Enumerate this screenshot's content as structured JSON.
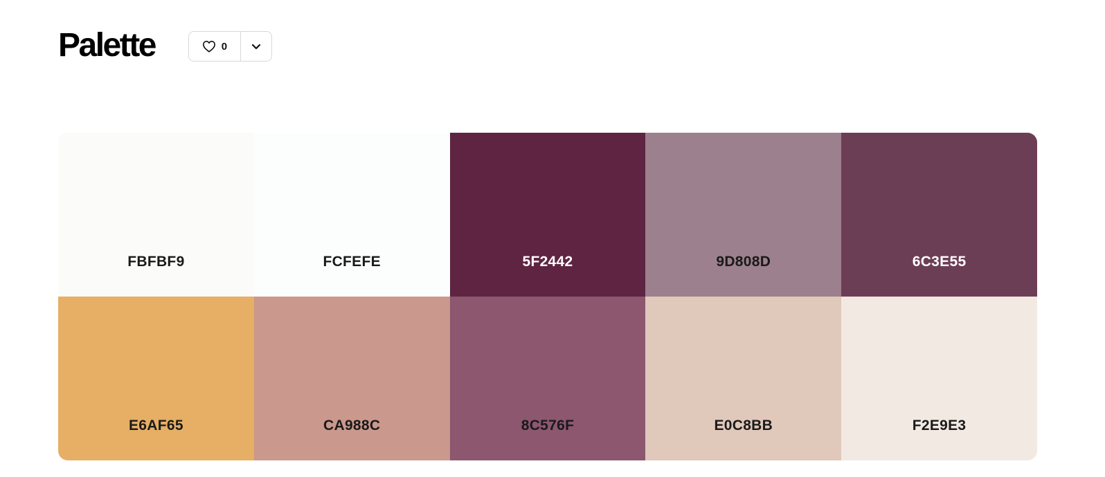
{
  "header": {
    "title": "Palette",
    "like_count": "0"
  },
  "icons": {
    "like": "heart-icon",
    "more": "chevron-down-icon"
  },
  "palette": {
    "swatches": [
      {
        "hex": "FBFBF9",
        "color": "#FBFBF9",
        "text_color": "#1a1a1a"
      },
      {
        "hex": "FCFEFE",
        "color": "#FCFEFE",
        "text_color": "#1a1a1a"
      },
      {
        "hex": "5F2442",
        "color": "#5F2442",
        "text_color": "#ffffff"
      },
      {
        "hex": "9D808D",
        "color": "#9D808D",
        "text_color": "#1a1a1a"
      },
      {
        "hex": "6C3E55",
        "color": "#6C3E55",
        "text_color": "#ffffff"
      },
      {
        "hex": "E6AF65",
        "color": "#E6AF65",
        "text_color": "#1a1a1a"
      },
      {
        "hex": "CA988C",
        "color": "#CA988C",
        "text_color": "#1a1a1a"
      },
      {
        "hex": "8C576F",
        "color": "#8C576F",
        "text_color": "#1a1a1a"
      },
      {
        "hex": "E0C8BB",
        "color": "#E0C8BB",
        "text_color": "#1a1a1a"
      },
      {
        "hex": "F2E9E3",
        "color": "#F2E9E3",
        "text_color": "#1a1a1a"
      }
    ]
  }
}
